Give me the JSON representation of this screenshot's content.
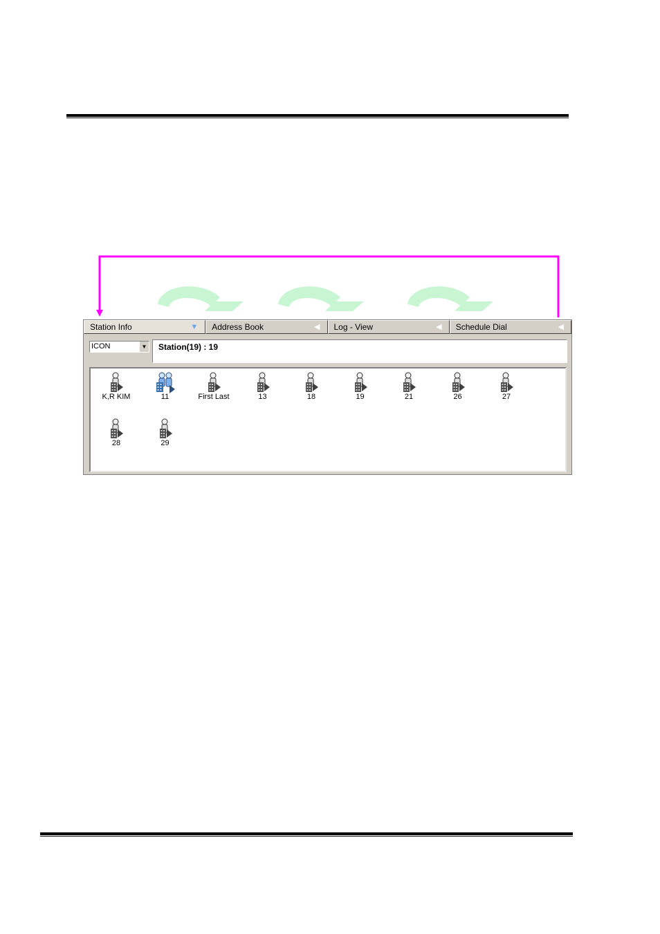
{
  "tabs": [
    {
      "label": "Station Info",
      "active": true
    },
    {
      "label": "Address Book",
      "active": false
    },
    {
      "label": "Log - View",
      "active": false
    },
    {
      "label": "Schedule Dial",
      "active": false
    }
  ],
  "view_select": {
    "value": "ICON"
  },
  "status": {
    "text": "Station(19) :  19"
  },
  "stations": [
    {
      "label": "K,R KIM",
      "icon": "station-phone-user-icon"
    },
    {
      "label": "11",
      "icon": "station-group-icon"
    },
    {
      "label": "First Last",
      "icon": "station-phone-user-icon"
    },
    {
      "label": "13",
      "icon": "station-phone-user-icon"
    },
    {
      "label": "18",
      "icon": "station-phone-user-icon"
    },
    {
      "label": "19",
      "icon": "station-phone-user-icon"
    },
    {
      "label": "21",
      "icon": "station-phone-user-icon"
    },
    {
      "label": "26",
      "icon": "station-phone-user-icon"
    },
    {
      "label": "27",
      "icon": "station-phone-user-icon"
    },
    {
      "label": "28",
      "icon": "station-phone-user-icon"
    },
    {
      "label": "29",
      "icon": "station-phone-user-icon"
    }
  ],
  "colors": {
    "nav_loop_arrow": "#ff00ff",
    "tab_cycle_arrow": "#c8f5d2",
    "active_tab_arrow": "#6ea6ee",
    "panel_bg": "#d4d0c8"
  }
}
